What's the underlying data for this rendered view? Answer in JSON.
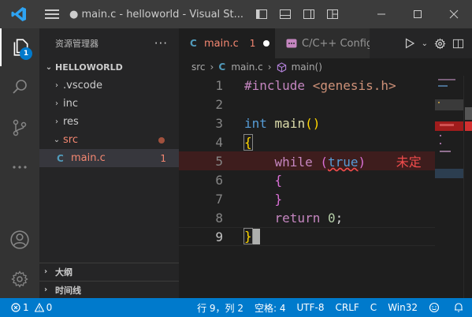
{
  "window": {
    "title": "● main.c - helloworld - Visual St..."
  },
  "activity": {
    "explorer_badge": "1"
  },
  "sidebar": {
    "header": "资源管理器",
    "more": "···",
    "root": "HELLOWORLD",
    "items": [
      {
        "label": ".vscode"
      },
      {
        "label": "inc"
      },
      {
        "label": "res"
      },
      {
        "label": "src"
      },
      {
        "label": "main.c",
        "count": "1"
      }
    ],
    "outline": "大纲",
    "timeline": "时间线"
  },
  "tabs": [
    {
      "letter": "C",
      "label": "main.c",
      "count": "1"
    },
    {
      "label": "C/C++ Configu"
    }
  ],
  "breadcrumb": {
    "folder": "src",
    "file_letter": "C",
    "file": "main.c",
    "symbol": "main()"
  },
  "editor": {
    "lines": [
      {
        "n": "1",
        "inc": "#include",
        "hdr": "<genesis.h>"
      },
      {
        "n": "2"
      },
      {
        "n": "3",
        "type": "int",
        "fn": "main",
        "paren": "()"
      },
      {
        "n": "4",
        "brace": "{"
      },
      {
        "n": "5",
        "kw": "while",
        "p_open": "(",
        "val": "true",
        "p_close": ")",
        "error": "未定"
      },
      {
        "n": "6",
        "brace": "{"
      },
      {
        "n": "7",
        "brace": "}"
      },
      {
        "n": "8",
        "kw": "return",
        "num": "0",
        "semi": ";"
      },
      {
        "n": "9",
        "brace": "}"
      }
    ]
  },
  "statusbar": {
    "errors": "1",
    "warnings": "0",
    "position": "行 9，列 2",
    "spaces": "空格: 4",
    "encoding": "UTF-8",
    "eol": "CRLF",
    "language": "C",
    "platform": "Win32"
  },
  "colors": {
    "accent": "#007acc",
    "error": "#f14c4c",
    "modified": "#f48771"
  }
}
